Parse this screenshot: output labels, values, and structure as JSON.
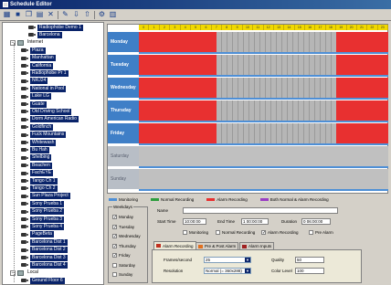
{
  "window": {
    "title": "Schedule Editor"
  },
  "toolbar": {
    "icons": [
      "new-schedule-icon",
      "save-icon",
      "copy-icon",
      "paste-icon",
      "delete-icon",
      "edit-icon",
      "import-icon",
      "export-icon",
      "settings-icon",
      "grid-icon"
    ]
  },
  "tree": {
    "items": [
      {
        "label": "Radiophobe Demo 1",
        "type": "cam",
        "indent": 3
      },
      {
        "label": "Barcelona",
        "type": "cam",
        "indent": 3
      },
      {
        "label": "Internet",
        "type": "grp",
        "indent": 1
      },
      {
        "label": "Plaza",
        "type": "cam",
        "indent": 2
      },
      {
        "label": "Manhattan",
        "type": "cam",
        "indent": 2
      },
      {
        "label": "California",
        "type": "cam",
        "indent": 2
      },
      {
        "label": "Radiophobe Pr 1",
        "type": "cam",
        "indent": 2
      },
      {
        "label": "NRJ24",
        "type": "cam",
        "indent": 2
      },
      {
        "label": "National in Pool",
        "type": "cam",
        "indent": 2
      },
      {
        "label": "Lake LG",
        "type": "cam",
        "indent": 2
      },
      {
        "label": "Guate",
        "type": "cam",
        "indent": 2
      },
      {
        "label": "Old Driving School",
        "type": "cam",
        "indent": 2
      },
      {
        "label": "Dorm American Radio",
        "type": "cam",
        "indent": 2
      },
      {
        "label": "Goldfinch",
        "type": "cam",
        "indent": 2
      },
      {
        "label": "Fuck Mountains",
        "type": "cam",
        "indent": 2
      },
      {
        "label": "Whitewash",
        "type": "cam",
        "indent": 2
      },
      {
        "label": "Bu Hah",
        "type": "cam",
        "indent": 2
      },
      {
        "label": "Shelbing",
        "type": "cam",
        "indent": 2
      },
      {
        "label": "Beachen",
        "type": "cam",
        "indent": 2
      },
      {
        "label": "FachEYE",
        "type": "cam",
        "indent": 2
      },
      {
        "label": "Tango Ch 1",
        "type": "cam",
        "indent": 2
      },
      {
        "label": "Tango Ch 2",
        "type": "cam",
        "indent": 2
      },
      {
        "label": "Sun Plaza Project",
        "type": "cam",
        "indent": 2
      },
      {
        "label": "Sony Prueba 1",
        "type": "cam",
        "indent": 2
      },
      {
        "label": "Sony Prueba 2",
        "type": "cam",
        "indent": 2
      },
      {
        "label": "Sony Prueba 3",
        "type": "cam",
        "indent": 2
      },
      {
        "label": "Sony Prueba 4",
        "type": "cam",
        "indent": 2
      },
      {
        "label": "PageBeta",
        "type": "cam",
        "indent": 2
      },
      {
        "label": "Barcelona Dist 1",
        "type": "cam",
        "indent": 2
      },
      {
        "label": "Barcelona Dist 2",
        "type": "cam",
        "indent": 2
      },
      {
        "label": "Barcelona Dist 3",
        "type": "cam",
        "indent": 2
      },
      {
        "label": "Barcelona Dist 4",
        "type": "cam",
        "indent": 2
      },
      {
        "label": "Local",
        "type": "grp",
        "indent": 1
      },
      {
        "label": "Ground Floor 6",
        "type": "cam",
        "indent": 2
      }
    ]
  },
  "schedule": {
    "hours": [
      "0",
      "1",
      "2",
      "3",
      "4",
      "5",
      "6",
      "7",
      "8",
      "9",
      "10",
      "11",
      "12",
      "13",
      "14",
      "15",
      "16",
      "17",
      "18",
      "19",
      "20",
      "21",
      "22",
      "23"
    ],
    "days": [
      {
        "label": "Monday",
        "enabled": true,
        "segments": [
          {
            "start": 0,
            "end": 7.5,
            "kind": "red"
          },
          {
            "start": 7.5,
            "end": 19,
            "kind": "gray"
          },
          {
            "start": 19,
            "end": 24,
            "kind": "red"
          }
        ]
      },
      {
        "label": "Tuesday",
        "enabled": true,
        "segments": [
          {
            "start": 0,
            "end": 7.5,
            "kind": "red"
          },
          {
            "start": 7.5,
            "end": 19,
            "kind": "gray"
          },
          {
            "start": 19,
            "end": 24,
            "kind": "red"
          }
        ]
      },
      {
        "label": "Wednesday",
        "enabled": true,
        "segments": [
          {
            "start": 0,
            "end": 7.5,
            "kind": "red"
          },
          {
            "start": 7.5,
            "end": 19,
            "kind": "gray"
          },
          {
            "start": 19,
            "end": 24,
            "kind": "red"
          }
        ]
      },
      {
        "label": "Thursday",
        "enabled": true,
        "segments": [
          {
            "start": 0,
            "end": 7.5,
            "kind": "red"
          },
          {
            "start": 7.5,
            "end": 19,
            "kind": "gray"
          },
          {
            "start": 19,
            "end": 24,
            "kind": "red"
          }
        ]
      },
      {
        "label": "Friday",
        "enabled": true,
        "segments": [
          {
            "start": 0,
            "end": 7.5,
            "kind": "red"
          },
          {
            "start": 7.5,
            "end": 19,
            "kind": "gray"
          },
          {
            "start": 19,
            "end": 24,
            "kind": "red"
          }
        ]
      },
      {
        "label": "Saturday",
        "enabled": false,
        "segments": []
      },
      {
        "label": "Sunday",
        "enabled": false,
        "segments": []
      }
    ]
  },
  "legend": [
    {
      "label": "Monitoring",
      "color": "#4e8fd6"
    },
    {
      "label": "Normal Recording",
      "color": "#2e9e3e"
    },
    {
      "label": "Alarm Recording",
      "color": "#e83030"
    },
    {
      "label": "Both Normal & Alarm Recording",
      "color": "#9a3ec4"
    }
  ],
  "weekdays": {
    "title": "Weekdays",
    "items": [
      {
        "label": "Monday",
        "checked": true
      },
      {
        "label": "Tuesday",
        "checked": true
      },
      {
        "label": "Wednesday",
        "checked": true
      },
      {
        "label": "Thursday",
        "checked": true
      },
      {
        "label": "Friday",
        "checked": true
      },
      {
        "label": "Saturday",
        "checked": false
      },
      {
        "label": "Sunday",
        "checked": false
      }
    ]
  },
  "detail": {
    "name_label": "Name",
    "name_value": "",
    "start_label": "Start Time",
    "start_value": "10:00:00",
    "end_label": "End Time",
    "end_value": "1  00:00:00",
    "duration_label": "Duration",
    "duration_value": "0  06:00:00",
    "modes": [
      {
        "label": "Monitoring",
        "checked": false
      },
      {
        "label": "Normal Recording",
        "checked": false
      },
      {
        "label": "Alarm Recording",
        "checked": true
      },
      {
        "label": "Pre Alarm",
        "checked": false
      }
    ],
    "tabs": [
      "Alarm Recording",
      "Pre & Post Alarm",
      "Alarm Inputs"
    ],
    "frames_label": "Frames/second",
    "frames_value": "25",
    "resolution_label": "Resolution",
    "resolution_value": "Normal (= 360x288)",
    "quality_label": "Quality",
    "quality_value": "50",
    "color_label": "Color Level",
    "color_value": "100"
  }
}
